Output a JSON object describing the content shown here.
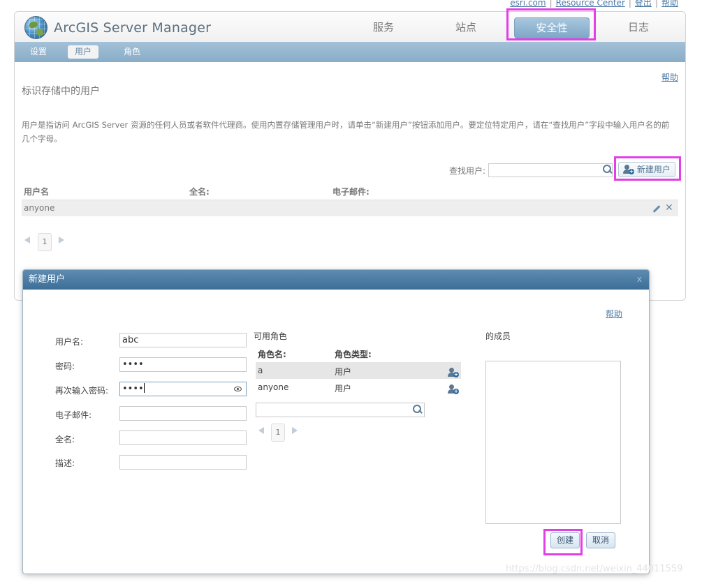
{
  "top_links": [
    "esri.com",
    "Resource Center",
    "登出",
    "帮助"
  ],
  "app": {
    "title": "ArcGIS Server Manager"
  },
  "nav": {
    "tabs": [
      {
        "label": "服务"
      },
      {
        "label": "站点"
      },
      {
        "label": "安全性",
        "active": true
      },
      {
        "label": "日志"
      }
    ]
  },
  "subnav": {
    "items": [
      {
        "label": "设置"
      },
      {
        "label": "用户",
        "active": true
      },
      {
        "label": "角色"
      }
    ]
  },
  "page": {
    "help": "帮助",
    "heading": "标识存储中的用户",
    "description": "用户是指访问 ArcGIS Server 资源的任何人员或者软件代理商。使用内置存储管理用户时，请单击“新建用户”按钮添加用户。要定位特定用户，请在“查找用户”字段中输入用户名的前几个字母。",
    "search_label": "查找用户:",
    "search_value": "",
    "new_user_button": "新建用户",
    "table": {
      "columns": [
        "用户名",
        "全名:",
        "电子邮件:"
      ],
      "rows": [
        {
          "username": "anyone",
          "fullname": "",
          "email": ""
        }
      ]
    },
    "pager": {
      "page": "1"
    }
  },
  "dialog": {
    "title": "新建用户",
    "close": "x",
    "help": "帮助",
    "fields": {
      "username": {
        "label": "用户名:",
        "value": "abc"
      },
      "password": {
        "label": "密码:",
        "value": "••••"
      },
      "password_confirm": {
        "label": "再次输入密码:",
        "value": "••••"
      },
      "email": {
        "label": "电子邮件:",
        "value": ""
      },
      "fullname": {
        "label": "全名:",
        "value": ""
      },
      "description": {
        "label": "描述:",
        "value": ""
      }
    },
    "available_roles": {
      "title": "可用角色",
      "columns": [
        "角色名:",
        "角色类型:"
      ],
      "rows": [
        {
          "name": "a",
          "type": "用户"
        },
        {
          "name": "anyone",
          "type": "用户"
        }
      ],
      "search_value": "",
      "pager": {
        "page": "1"
      }
    },
    "members": {
      "title": "的成员"
    },
    "create_button": "创建",
    "cancel_button": "取消"
  },
  "watermark": "https://blog.csdn.net/weixin_44011559",
  "colors": {
    "highlight": "#e23fe6",
    "accent": "#4a7aa3",
    "subnav": "#94b5ce"
  }
}
